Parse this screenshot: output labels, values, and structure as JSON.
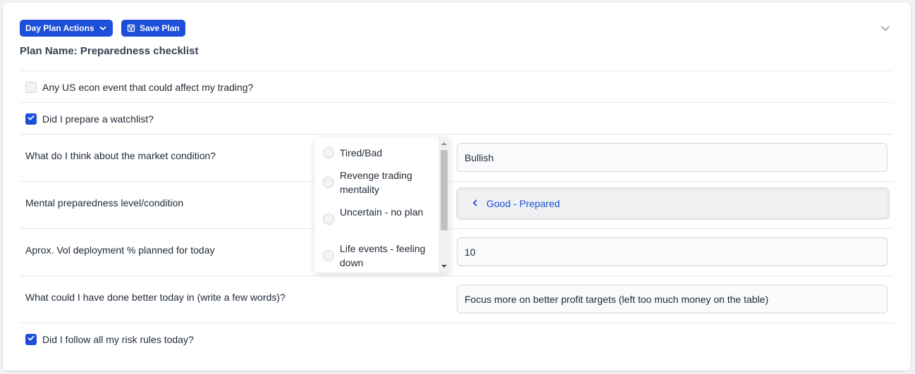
{
  "toolbar": {
    "day_plan_actions_label": "Day Plan Actions",
    "save_plan_label": "Save Plan"
  },
  "plan": {
    "title": "Plan Name: Preparedness checklist"
  },
  "checklist": {
    "items": [
      {
        "label": "Any US econ event that could affect my trading?",
        "checked": false
      },
      {
        "label": "Did I prepare a watchlist?",
        "checked": true
      },
      {
        "label": "Did I follow all my risk rules today?",
        "checked": true
      }
    ]
  },
  "questions": [
    {
      "label": "What do I think about the market condition?",
      "value": "Bullish"
    },
    {
      "label": "Mental preparedness level/condition",
      "value": "Good - Prepared"
    },
    {
      "label": "Aprox. Vol deployment % planned for today",
      "value": "10"
    },
    {
      "label": "What could  I have done better today in (write a few words)?",
      "value": "Focus more on better profit targets (left too much money on the table)"
    }
  ],
  "dropdown": {
    "options": [
      {
        "label": "Tired/Bad"
      },
      {
        "label": "Revenge trading mentality"
      },
      {
        "label": "Uncertain - no plan"
      },
      {
        "label": "Life events - feeling down"
      }
    ]
  },
  "colors": {
    "accent": "#1d4fd8",
    "border": "#e5e7eb"
  },
  "icons": {
    "chevron_down": "chevron-down-icon",
    "save": "save-icon",
    "check": "check-icon",
    "chevron_left": "chevron-left-icon"
  }
}
